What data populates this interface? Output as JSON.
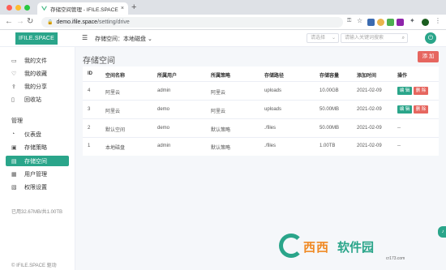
{
  "browser": {
    "tab_title": "存储空间管理 - IFILE.SPACE 个...",
    "url_host": "demo.ifile.space",
    "url_path": "/setting/drive"
  },
  "header": {
    "logo": "IFILE.SPACE",
    "space_label": "存储空间：",
    "space_value": "本地磁盘",
    "select_placeholder": "请选择",
    "search_placeholder": "请输入关键词搜索"
  },
  "sidebar": {
    "items": [
      {
        "label": "我的文件",
        "icon": "folder-icon"
      },
      {
        "label": "我的收藏",
        "icon": "heart-icon"
      },
      {
        "label": "我的分享",
        "icon": "share-icon"
      },
      {
        "label": "回收站",
        "icon": "trash-icon"
      }
    ],
    "group_label": "管理",
    "admin_items": [
      {
        "label": "仪表盘",
        "icon": "dashboard-icon"
      },
      {
        "label": "存储策略",
        "icon": "storage-icon"
      },
      {
        "label": "存储空间",
        "icon": "drive-icon"
      },
      {
        "label": "用户管理",
        "icon": "users-icon"
      },
      {
        "label": "权限设置",
        "icon": "permission-icon"
      }
    ],
    "usage": "已用32.67MB/共1.00TB",
    "footer": "© IFILE.SPACE 驱动"
  },
  "main": {
    "title": "存储空间",
    "add_label": "添 加",
    "columns": [
      "ID",
      "空间名称",
      "所属用户",
      "所属策略",
      "存储路径",
      "存储容量",
      "添加时间",
      "操作"
    ],
    "rows": [
      {
        "id": "4",
        "name": "阿里云",
        "user": "admin",
        "policy": "阿里云",
        "path": "uploads",
        "size": "10.00GB",
        "date": "2021-02-09",
        "actions": true
      },
      {
        "id": "3",
        "name": "阿里云",
        "user": "demo",
        "policy": "阿里云",
        "path": "uploads",
        "size": "50.00MB",
        "date": "2021-02-09",
        "actions": true
      },
      {
        "id": "2",
        "name": "默认空间",
        "user": "demo",
        "policy": "默认策略",
        "path": "./files",
        "size": "50.00MB",
        "date": "2021-02-09",
        "actions": false
      },
      {
        "id": "1",
        "name": "本地磁盘",
        "user": "admin",
        "policy": "默认策略",
        "path": "./files",
        "size": "1.00TB",
        "date": "2021-02-09",
        "actions": false
      }
    ],
    "edit_label": "编 辑",
    "delete_label": "删 除",
    "no_action": "--"
  },
  "watermark": {
    "t1": "西西",
    "t2": "软件园",
    "url": "cr173.com"
  },
  "colors": {
    "accent": "#2aa58a",
    "danger": "#e6665f"
  }
}
